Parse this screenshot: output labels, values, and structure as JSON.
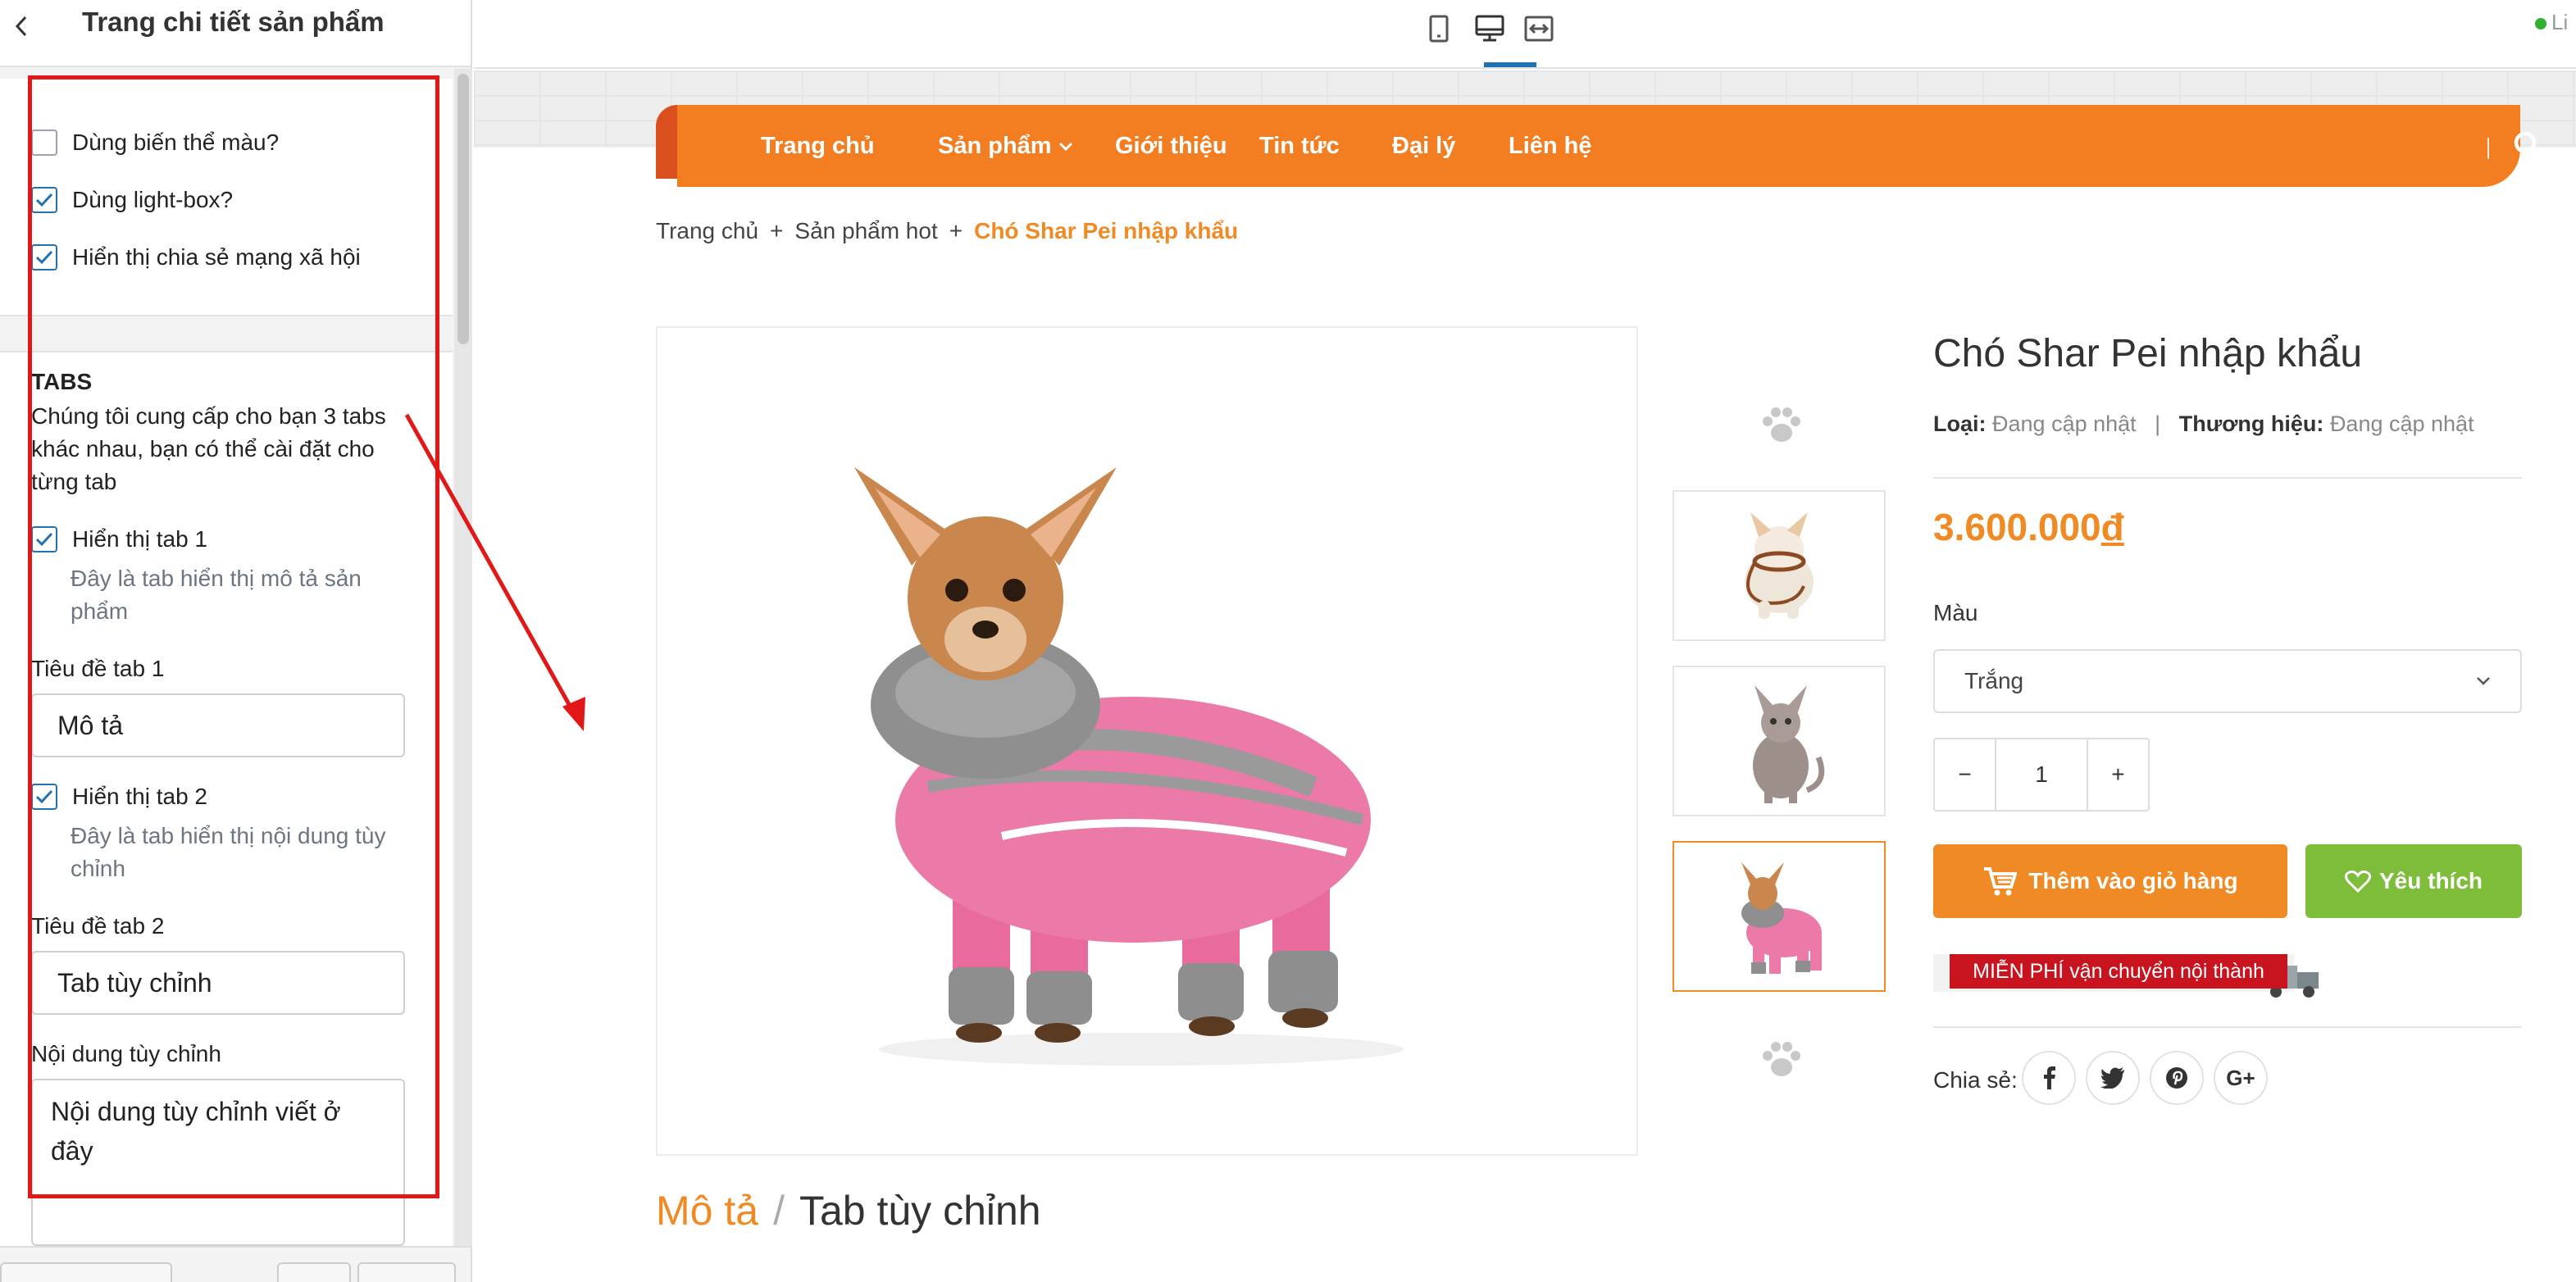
{
  "sidebar": {
    "title": "Trang chi tiết sản phẩm",
    "checkboxes_top": [
      {
        "label": "Dùng biến thể màu?",
        "checked": false
      },
      {
        "label": "Dùng light-box?",
        "checked": true
      },
      {
        "label": "Hiển thị chia sẻ mạng xã hội",
        "checked": true
      }
    ],
    "tabs_heading": "TABS",
    "tabs_intro": "Chúng tôi cung cấp cho bạn 3 tabs khác nhau, bạn có thể cài đặt cho từng tab",
    "tab1": {
      "show_label": "Hiển thị tab 1",
      "show_desc": "Đây là tab hiển thị mô tả sản phẩm",
      "title_label": "Tiêu đề tab 1",
      "title_value": "Mô tả"
    },
    "tab2": {
      "show_label": "Hiển thị tab 2",
      "show_desc": "Đây là tab hiển thị nội dung tùy chỉnh",
      "title_label": "Tiêu đề tab 2",
      "title_value": "Tab tùy chỉnh"
    },
    "custom_content_label": "Nội dung tùy chỉnh",
    "custom_content_value": "Nội dung tùy chỉnh viết ở đây"
  },
  "topbar": {
    "devices": [
      "mobile-icon",
      "desktop-icon",
      "fullwidth-icon"
    ],
    "active_device": "desktop-icon",
    "live_label": "Li"
  },
  "store": {
    "nav": [
      "Trang chủ",
      "Sản phẩm",
      "Giới thiệu",
      "Tin tức",
      "Đại lý",
      "Liên hệ"
    ],
    "breadcrumb": {
      "home": "Trang chủ",
      "category": "Sản phẩm hot",
      "separator": "+",
      "current": "Chó Shar Pei nhập khẩu"
    },
    "product": {
      "title": "Chó Shar Pei nhập khẩu",
      "type_label": "Loại:",
      "type_value": "Đang cập nhật",
      "brand_label": "Thương hiệu:",
      "brand_value": "Đang cập nhật",
      "meta_separator": "|",
      "price": "3.600.000",
      "currency": "đ",
      "option_label": "Màu",
      "option_selected": "Trắng",
      "qty_minus": "−",
      "qty_value": "1",
      "qty_plus": "+",
      "add_to_cart": "Thêm vào giỏ hàng",
      "wishlist": "Yêu thích",
      "shipping_banner": "MIỄN PHÍ vận chuyển nội thành",
      "share_label": "Chia sẻ:",
      "share_icons": [
        "facebook-icon",
        "twitter-icon",
        "pinterest-icon",
        "google-plus-icon"
      ]
    },
    "tabs": {
      "active": "Mô tả",
      "separator": "/",
      "other": "Tab tùy chỉnh"
    }
  },
  "colors": {
    "accent_orange": "#f08a24",
    "nav_orange": "#f37e22",
    "green": "#7dbd3a",
    "annotation_red": "#e21818",
    "checkbox_blue": "#2271b1"
  }
}
